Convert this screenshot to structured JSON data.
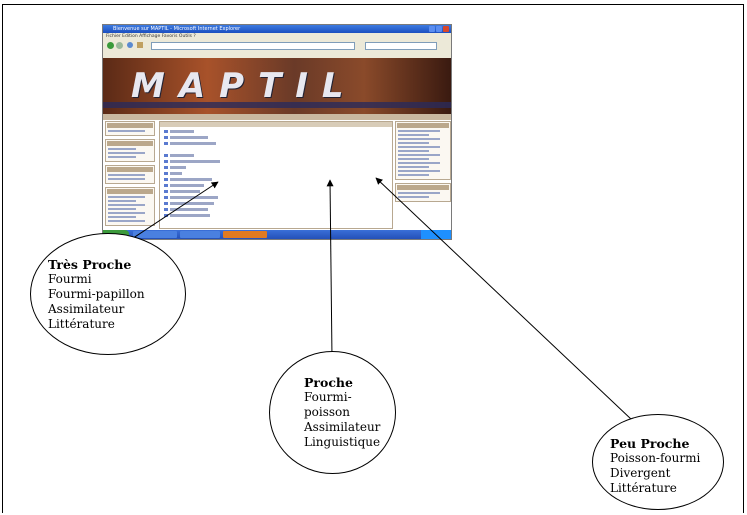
{
  "screenshot": {
    "window_title": "Bienvenue sur MAPTIL - Microsoft Internet Explorer",
    "menu": "Fichier  Edition  Affichage  Favoris  Outils  ?",
    "banner_text": "MAPTIL"
  },
  "callouts": [
    {
      "heading": "Très Proche",
      "lines": [
        "Fourmi",
        "Fourmi-papillon",
        "Assimilateur",
        "Littérature"
      ]
    },
    {
      "heading": "Proche",
      "lines": [
        "Fourmi-",
        "poisson",
        "Assimilateur",
        "Linguistique"
      ]
    },
    {
      "heading": "Peu Proche",
      "lines": [
        "Poisson-fourmi",
        "Divergent",
        "Littérature"
      ]
    }
  ]
}
